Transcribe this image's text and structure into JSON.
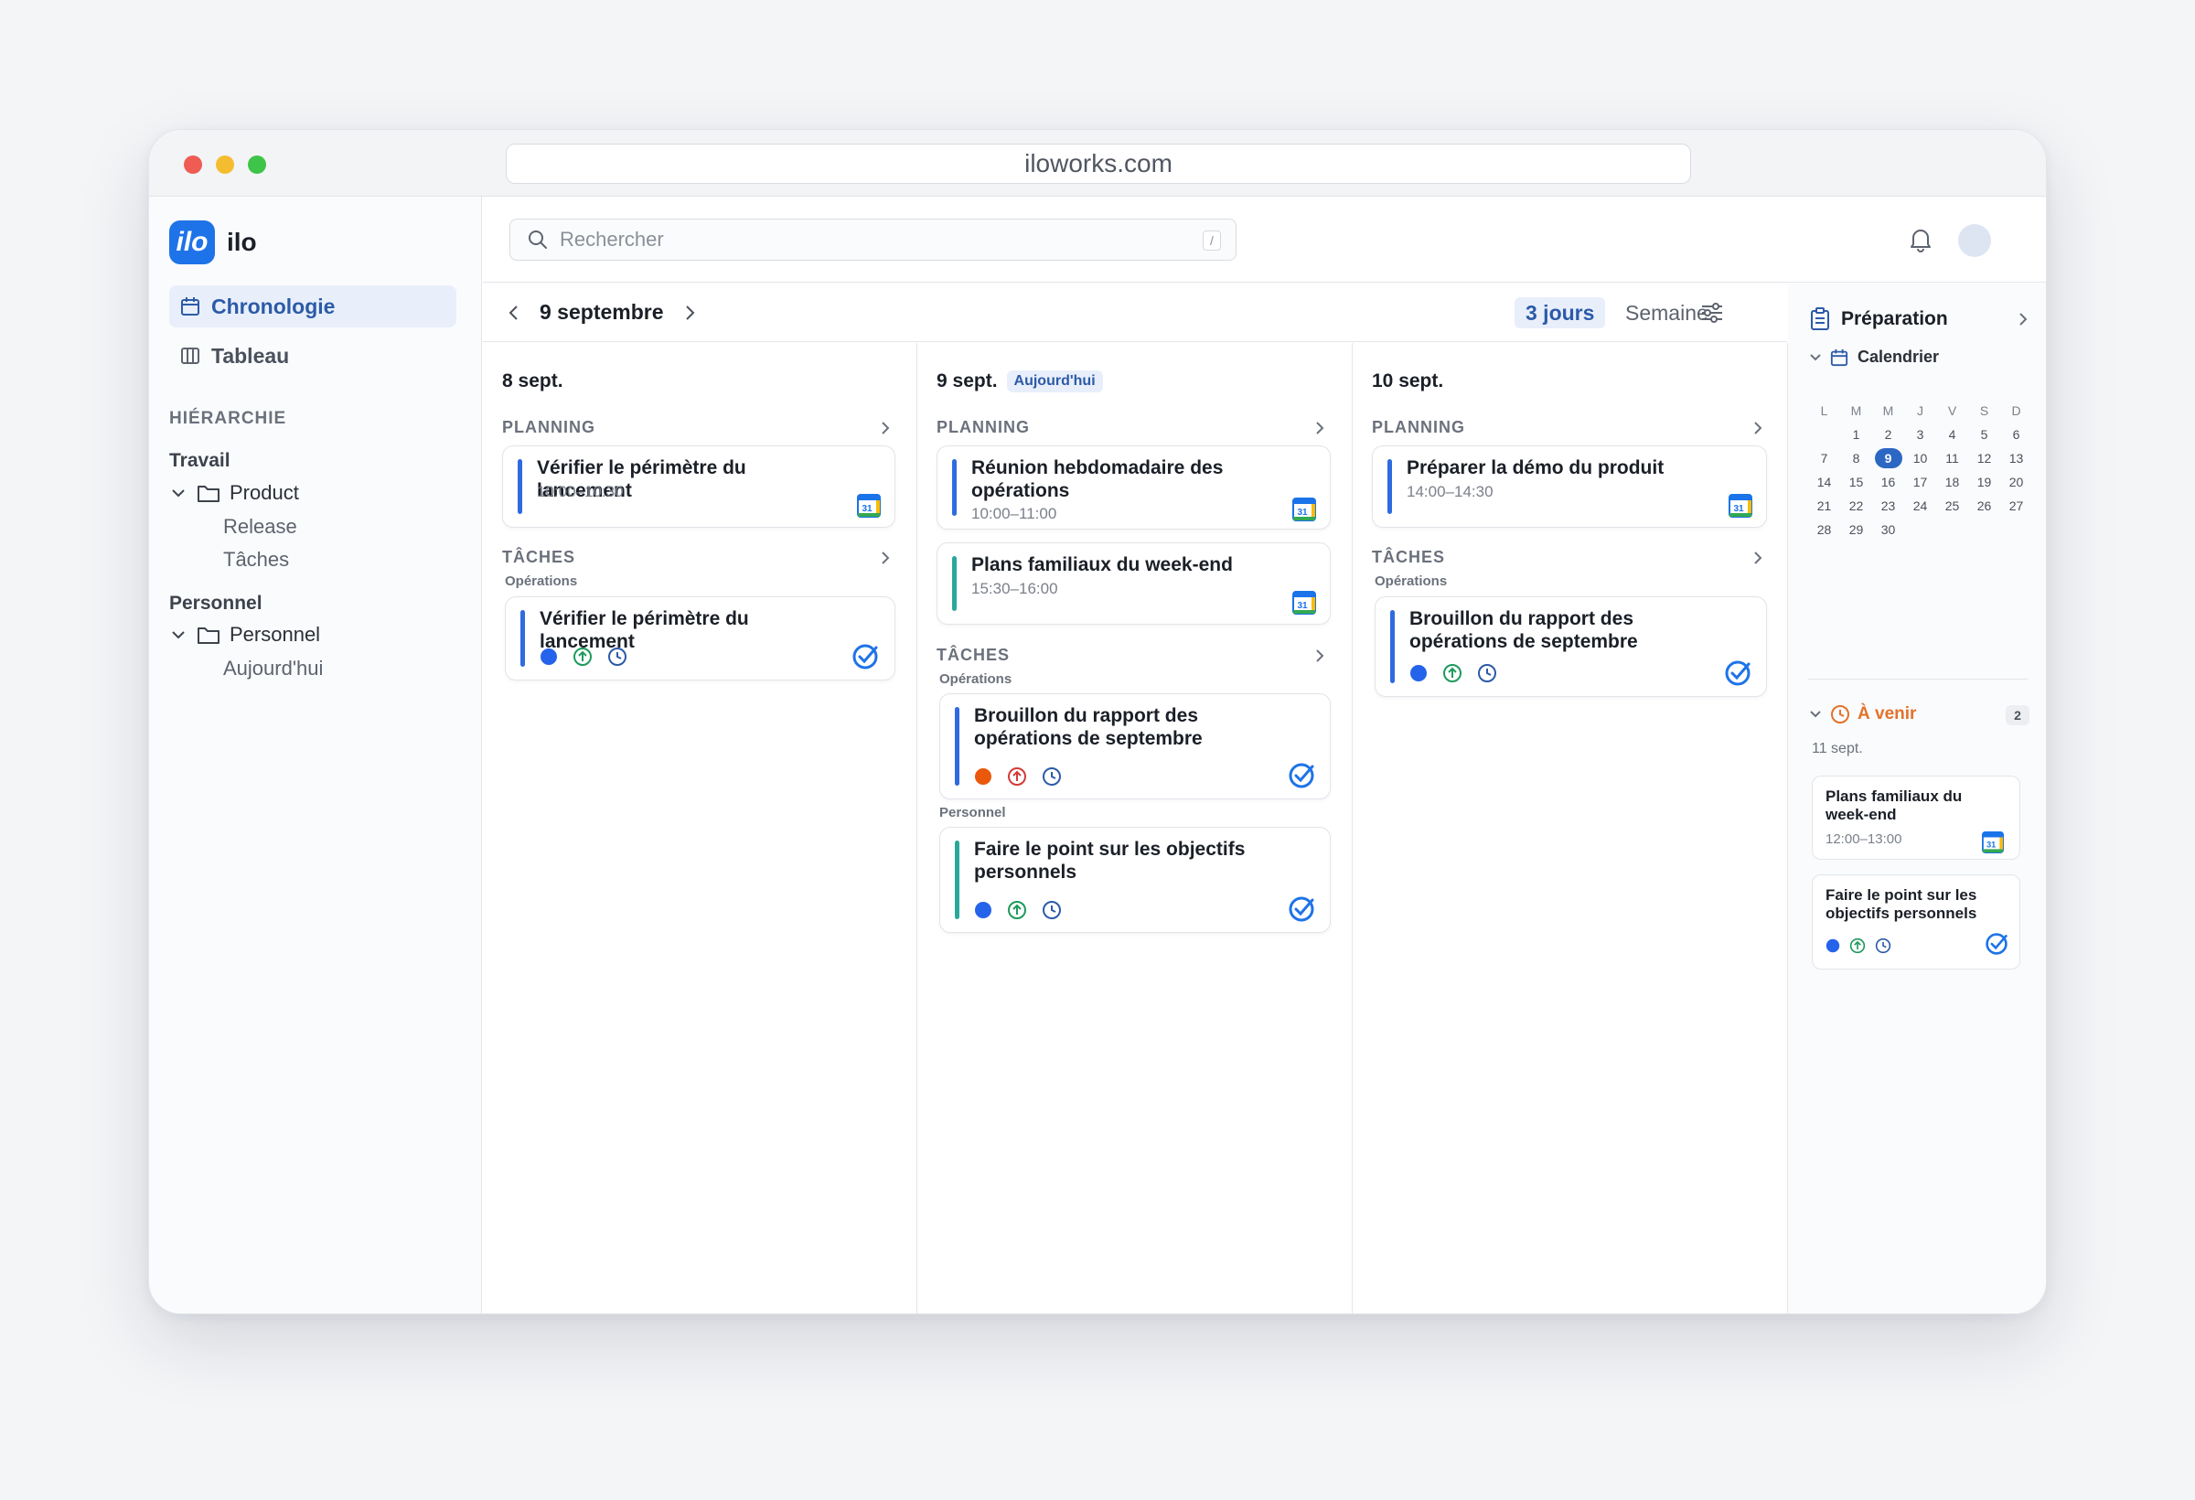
{
  "browser": {
    "url": "iloworks.com"
  },
  "sidebar": {
    "logo_text": "ilo",
    "brand": "ilo",
    "nav": [
      {
        "label": "Chronologie"
      },
      {
        "label": "Tableau"
      }
    ],
    "hierarchy_label": "HIÉRARCHIE",
    "groups": [
      {
        "label": "Travail",
        "folder": "Product",
        "children": [
          "Release",
          "Tâches"
        ]
      },
      {
        "label": "Personnel",
        "folder": "Personnel",
        "children": [
          "Aujourd'hui"
        ]
      }
    ]
  },
  "topbar": {
    "search_placeholder": "Rechercher",
    "shortcut": "/"
  },
  "datebar": {
    "title": "9 septembre",
    "view_3days": "3 jours",
    "view_week": "Semaine"
  },
  "columns": [
    {
      "date": "8 sept.",
      "planning_label": "PLANNING",
      "events": [
        {
          "title": "Vérifier le périmètre du lancement",
          "time": "10:00–10:30",
          "color": "#2f6be0"
        }
      ],
      "tasks_label": "TÂCHES",
      "task_groups": [
        {
          "project": "Opérations",
          "tasks": [
            {
              "title": "Vérifier le périmètre du lancement",
              "priority_color": "#2563eb",
              "bar_color": "#2f6be0"
            }
          ]
        }
      ]
    },
    {
      "date": "9 sept.",
      "today_badge": "Aujourd'hui",
      "planning_label": "PLANNING",
      "events": [
        {
          "title": "Réunion hebdomadaire des opérations",
          "time": "10:00–11:00",
          "color": "#2f6be0"
        },
        {
          "title": "Plans familiaux du week-end",
          "time": "15:30–16:00",
          "color": "#2aa89a"
        }
      ],
      "tasks_label": "TÂCHES",
      "task_groups": [
        {
          "project": "Opérations",
          "tasks": [
            {
              "title": "Brouillon du rapport des opérations de septembre",
              "priority_color": "#ea580c",
              "bar_color": "#2f6be0"
            }
          ]
        },
        {
          "project": "Personnel",
          "tasks": [
            {
              "title": "Faire le point sur les objectifs personnels",
              "priority_color": "#2563eb",
              "bar_color": "#2aa89a"
            }
          ]
        }
      ]
    },
    {
      "date": "10 sept.",
      "planning_label": "PLANNING",
      "events": [
        {
          "title": "Préparer la démo du produit",
          "time": "14:00–14:30",
          "color": "#2f6be0"
        }
      ],
      "tasks_label": "TÂCHES",
      "task_groups": [
        {
          "project": "Opérations",
          "tasks": [
            {
              "title": "Brouillon du rapport des opérations de septembre",
              "priority_color": "#2563eb",
              "bar_color": "#2f6be0"
            }
          ]
        }
      ]
    }
  ],
  "right_panel": {
    "title": "Préparation",
    "calendar_label": "Calendrier",
    "weekdays": [
      "L",
      "M",
      "M",
      "J",
      "V",
      "S",
      "D"
    ],
    "weeks": [
      [
        "",
        "1",
        "2",
        "3",
        "4",
        "5",
        "6"
      ],
      [
        "7",
        "8",
        "9",
        "10",
        "11",
        "12",
        "13"
      ],
      [
        "14",
        "15",
        "16",
        "17",
        "18",
        "19",
        "20"
      ],
      [
        "21",
        "22",
        "23",
        "24",
        "25",
        "26",
        "27"
      ],
      [
        "28",
        "29",
        "30",
        "",
        "",
        "",
        ""
      ]
    ],
    "today": "9",
    "upcoming_label": "À venir",
    "upcoming_count": "2",
    "upcoming_date": "11 sept.",
    "upcoming_items": [
      {
        "title": "Plans familiaux du week-end",
        "time": "12:00–13:00",
        "kind": "event"
      },
      {
        "title": "Faire le point sur les objectifs personnels",
        "kind": "task"
      }
    ]
  }
}
